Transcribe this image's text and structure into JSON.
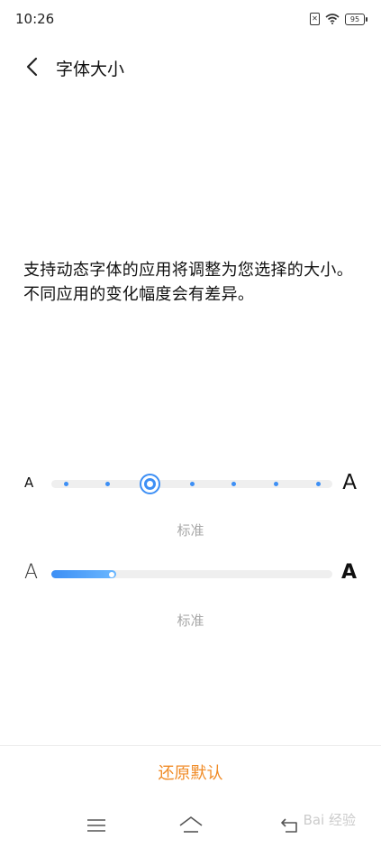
{
  "status_bar": {
    "time": "10:26",
    "sim_icon": "sim-missing-icon",
    "wifi_icon": "wifi-icon",
    "battery_level": "95"
  },
  "header": {
    "back_icon": "chevron-left-icon",
    "title": "字体大小"
  },
  "description": "支持动态字体的应用将调整为您选择的大小。不同应用的变化幅度会有差异。",
  "font_size_slider": {
    "small_glyph": "A",
    "large_glyph": "A",
    "steps": 7,
    "selected_step_index": 2,
    "level_label": "标准"
  },
  "weight_slider": {
    "small_glyph": "A",
    "large_glyph": "A",
    "fill_fraction": 0.23,
    "level_label": "标准"
  },
  "reset_button": {
    "label": "还原默认",
    "color": "#f08a24"
  },
  "nav_bar": {
    "menu_icon": "menu-icon",
    "home_icon": "home-icon",
    "back_icon": "back-arrow-icon"
  },
  "watermark": "Bai 经验",
  "accent_color": "#3d8ff5"
}
